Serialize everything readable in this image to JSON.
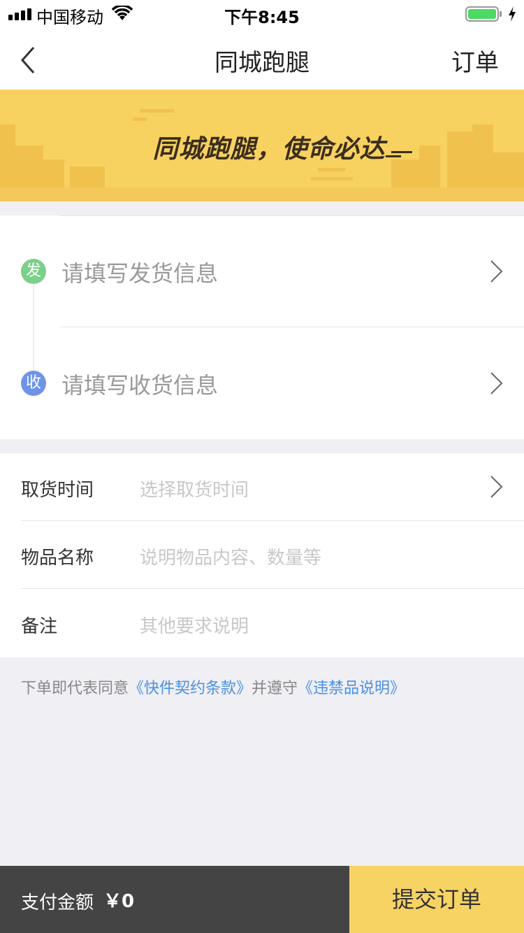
{
  "status_bar": {
    "carrier": "中国移动",
    "time": "下午8:45"
  },
  "nav": {
    "title": "同城跑腿",
    "right_label": "订单"
  },
  "banner": {
    "slogan": "同城跑腿，使命必达"
  },
  "address": {
    "sender_badge": "发",
    "sender_placeholder": "请填写发货信息",
    "receiver_badge": "收",
    "receiver_placeholder": "请填写收货信息"
  },
  "form": {
    "rows": [
      {
        "label": "取货时间",
        "placeholder": "选择取货时间"
      },
      {
        "label": "物品名称",
        "placeholder": "说明物品内容、数量等"
      },
      {
        "label": "备注",
        "placeholder": "其他要求说明"
      }
    ]
  },
  "agreement": {
    "prefix": "下单即代表同意",
    "link1": "《快件契约条款》",
    "middle": "并遵守",
    "link2": "《违禁品说明》"
  },
  "bottom": {
    "pay_label": "支付金额",
    "pay_amount": "￥0",
    "submit_label": "提交订单"
  },
  "colors": {
    "accent_yellow": "#f7d364",
    "banner_yellow": "#f8d260",
    "sender_green": "#7bd08a",
    "receiver_blue": "#6f93e8",
    "link_blue": "#4a90e2",
    "bottom_dark": "#444444"
  }
}
